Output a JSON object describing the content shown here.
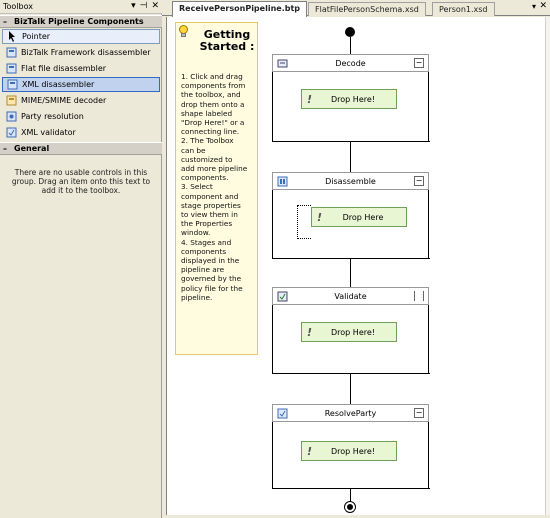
{
  "toolbox": {
    "title": "Toolbox",
    "controls": [
      "▾",
      "⊣",
      "✕"
    ],
    "category_pipeline": {
      "sign": "–",
      "label": "BizTalk Pipeline Components"
    },
    "items": [
      {
        "label": "Pointer",
        "icon": "pointer-icon"
      },
      {
        "label": "BizTalk Framework disassembler",
        "icon": "component-icon"
      },
      {
        "label": "Flat file disassembler",
        "icon": "component-icon"
      },
      {
        "label": "XML disassembler",
        "icon": "component-icon"
      },
      {
        "label": "MIME/SMIME decoder",
        "icon": "component-icon"
      },
      {
        "label": "Party resolution",
        "icon": "component-icon"
      },
      {
        "label": "XML validator",
        "icon": "component-icon"
      }
    ],
    "category_general": {
      "sign": "–",
      "label": "General"
    },
    "general_text": "There are no usable controls in this\ngroup. Drag an item onto this text to\nadd it to the toolbox."
  },
  "tabs": [
    {
      "label": "ReceivePersonPipeline.btp",
      "active": true
    },
    {
      "label": "FlatFilePersonSchema.xsd",
      "active": false
    },
    {
      "label": "Person1.xsd",
      "active": false
    }
  ],
  "tab_dropdown": "▾",
  "tab_close": "✕",
  "getting_started": {
    "title": "Getting Started :",
    "body": "1. Click and drag\ncomponents from\nthe toolbox, and\ndrop them onto a\nshape labeled\n\"Drop Here!\" or a\nconnecting line.\n2. The Toolbox\ncan be\ncustomized to\nadd more pipeline\ncomponents.\n3. Select\ncomponent and\nstage properties\nto view them in\nthe Properties\nwindow.\n4. Stages and\ncomponents\ndisplayed in the\npipeline are\ngoverned by the\npolicy file for the\npipeline."
  },
  "stages": [
    {
      "name": "Decode",
      "drop_label": "Drop Here!"
    },
    {
      "name": "Disassemble",
      "drop_label": "Drop Here"
    },
    {
      "name": "Validate",
      "drop_label": "Drop Here!"
    },
    {
      "name": "ResolveParty",
      "drop_label": "Drop Here!"
    }
  ],
  "colors": {
    "drop_fill": "#e8f6d4",
    "panel_yellow": "#fffce0",
    "selection": "#c1d2ee"
  }
}
